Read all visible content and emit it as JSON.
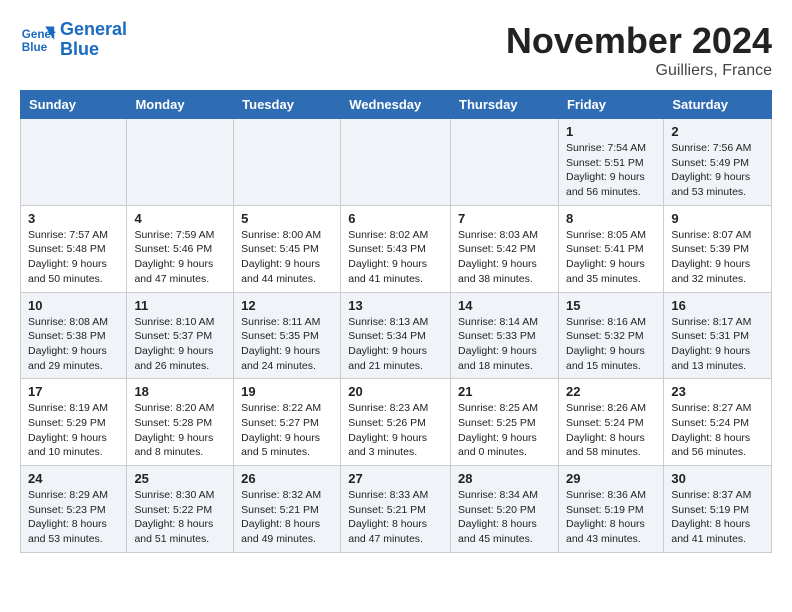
{
  "logo": {
    "line1": "General",
    "line2": "Blue"
  },
  "title": "November 2024",
  "location": "Guilliers, France",
  "days_of_week": [
    "Sunday",
    "Monday",
    "Tuesday",
    "Wednesday",
    "Thursday",
    "Friday",
    "Saturday"
  ],
  "weeks": [
    [
      {
        "day": "",
        "info": ""
      },
      {
        "day": "",
        "info": ""
      },
      {
        "day": "",
        "info": ""
      },
      {
        "day": "",
        "info": ""
      },
      {
        "day": "",
        "info": ""
      },
      {
        "day": "1",
        "info": "Sunrise: 7:54 AM\nSunset: 5:51 PM\nDaylight: 9 hours and 56 minutes."
      },
      {
        "day": "2",
        "info": "Sunrise: 7:56 AM\nSunset: 5:49 PM\nDaylight: 9 hours and 53 minutes."
      }
    ],
    [
      {
        "day": "3",
        "info": "Sunrise: 7:57 AM\nSunset: 5:48 PM\nDaylight: 9 hours and 50 minutes."
      },
      {
        "day": "4",
        "info": "Sunrise: 7:59 AM\nSunset: 5:46 PM\nDaylight: 9 hours and 47 minutes."
      },
      {
        "day": "5",
        "info": "Sunrise: 8:00 AM\nSunset: 5:45 PM\nDaylight: 9 hours and 44 minutes."
      },
      {
        "day": "6",
        "info": "Sunrise: 8:02 AM\nSunset: 5:43 PM\nDaylight: 9 hours and 41 minutes."
      },
      {
        "day": "7",
        "info": "Sunrise: 8:03 AM\nSunset: 5:42 PM\nDaylight: 9 hours and 38 minutes."
      },
      {
        "day": "8",
        "info": "Sunrise: 8:05 AM\nSunset: 5:41 PM\nDaylight: 9 hours and 35 minutes."
      },
      {
        "day": "9",
        "info": "Sunrise: 8:07 AM\nSunset: 5:39 PM\nDaylight: 9 hours and 32 minutes."
      }
    ],
    [
      {
        "day": "10",
        "info": "Sunrise: 8:08 AM\nSunset: 5:38 PM\nDaylight: 9 hours and 29 minutes."
      },
      {
        "day": "11",
        "info": "Sunrise: 8:10 AM\nSunset: 5:37 PM\nDaylight: 9 hours and 26 minutes."
      },
      {
        "day": "12",
        "info": "Sunrise: 8:11 AM\nSunset: 5:35 PM\nDaylight: 9 hours and 24 minutes."
      },
      {
        "day": "13",
        "info": "Sunrise: 8:13 AM\nSunset: 5:34 PM\nDaylight: 9 hours and 21 minutes."
      },
      {
        "day": "14",
        "info": "Sunrise: 8:14 AM\nSunset: 5:33 PM\nDaylight: 9 hours and 18 minutes."
      },
      {
        "day": "15",
        "info": "Sunrise: 8:16 AM\nSunset: 5:32 PM\nDaylight: 9 hours and 15 minutes."
      },
      {
        "day": "16",
        "info": "Sunrise: 8:17 AM\nSunset: 5:31 PM\nDaylight: 9 hours and 13 minutes."
      }
    ],
    [
      {
        "day": "17",
        "info": "Sunrise: 8:19 AM\nSunset: 5:29 PM\nDaylight: 9 hours and 10 minutes."
      },
      {
        "day": "18",
        "info": "Sunrise: 8:20 AM\nSunset: 5:28 PM\nDaylight: 9 hours and 8 minutes."
      },
      {
        "day": "19",
        "info": "Sunrise: 8:22 AM\nSunset: 5:27 PM\nDaylight: 9 hours and 5 minutes."
      },
      {
        "day": "20",
        "info": "Sunrise: 8:23 AM\nSunset: 5:26 PM\nDaylight: 9 hours and 3 minutes."
      },
      {
        "day": "21",
        "info": "Sunrise: 8:25 AM\nSunset: 5:25 PM\nDaylight: 9 hours and 0 minutes."
      },
      {
        "day": "22",
        "info": "Sunrise: 8:26 AM\nSunset: 5:24 PM\nDaylight: 8 hours and 58 minutes."
      },
      {
        "day": "23",
        "info": "Sunrise: 8:27 AM\nSunset: 5:24 PM\nDaylight: 8 hours and 56 minutes."
      }
    ],
    [
      {
        "day": "24",
        "info": "Sunrise: 8:29 AM\nSunset: 5:23 PM\nDaylight: 8 hours and 53 minutes."
      },
      {
        "day": "25",
        "info": "Sunrise: 8:30 AM\nSunset: 5:22 PM\nDaylight: 8 hours and 51 minutes."
      },
      {
        "day": "26",
        "info": "Sunrise: 8:32 AM\nSunset: 5:21 PM\nDaylight: 8 hours and 49 minutes."
      },
      {
        "day": "27",
        "info": "Sunrise: 8:33 AM\nSunset: 5:21 PM\nDaylight: 8 hours and 47 minutes."
      },
      {
        "day": "28",
        "info": "Sunrise: 8:34 AM\nSunset: 5:20 PM\nDaylight: 8 hours and 45 minutes."
      },
      {
        "day": "29",
        "info": "Sunrise: 8:36 AM\nSunset: 5:19 PM\nDaylight: 8 hours and 43 minutes."
      },
      {
        "day": "30",
        "info": "Sunrise: 8:37 AM\nSunset: 5:19 PM\nDaylight: 8 hours and 41 minutes."
      }
    ]
  ]
}
